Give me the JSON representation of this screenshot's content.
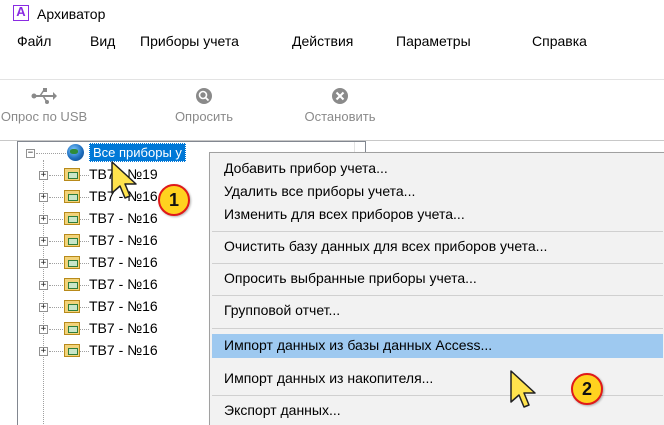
{
  "window": {
    "title": "Архиватор",
    "icon": "archiver-app-icon",
    "icon_letter": "A"
  },
  "menu": [
    {
      "label": "Файл"
    },
    {
      "label": "Вид"
    },
    {
      "label": "Приборы учета"
    },
    {
      "label": "Действия"
    },
    {
      "label": "Параметры"
    },
    {
      "label": "Справка"
    }
  ],
  "toolbar": {
    "usb": {
      "label": "Опрос по USB",
      "icon": "usb-icon"
    },
    "poll": {
      "label": "Опросить",
      "icon": "poll-icon"
    },
    "stop": {
      "label": "Остановить",
      "icon": "stop-icon"
    }
  },
  "tree": {
    "root_label": "Все приборы у",
    "root_icon": "globe-icon",
    "children": [
      {
        "label": "ТВ7 - №19"
      },
      {
        "label": "ТВ7 - №16"
      },
      {
        "label": "ТВ7 - №16"
      },
      {
        "label": "ТВ7 - №16"
      },
      {
        "label": "ТВ7 - №16"
      },
      {
        "label": "ТВ7 - №16"
      },
      {
        "label": "ТВ7 - №16"
      },
      {
        "label": "ТВ7 - №16"
      },
      {
        "label": "ТВ7 - №16"
      }
    ]
  },
  "context_menu": {
    "items": [
      {
        "label": "Добавить прибор учета..."
      },
      {
        "label": "Удалить все приборы учета..."
      },
      {
        "label": "Изменить для всех приборов учета..."
      },
      {
        "label": "Очистить базу данных для всех приборов учета..."
      },
      {
        "label": "Опросить выбранные приборы учета..."
      },
      {
        "label": "Групповой отчет..."
      },
      {
        "label": "Импорт данных из базы данных Access..."
      },
      {
        "label": "Импорт данных из накопителя..."
      },
      {
        "label": "Экспорт данных..."
      }
    ],
    "highlighted_label": "Импорт данных из базы данных Access..."
  },
  "annotations": {
    "step1": "1",
    "step2": "2"
  },
  "colors": {
    "selection": "#0078d7",
    "menu_highlight": "#9ec9f0",
    "badge_fill": "#ffd21f",
    "badge_border": "#e01919",
    "cursor_fill": "#ffe34d"
  }
}
